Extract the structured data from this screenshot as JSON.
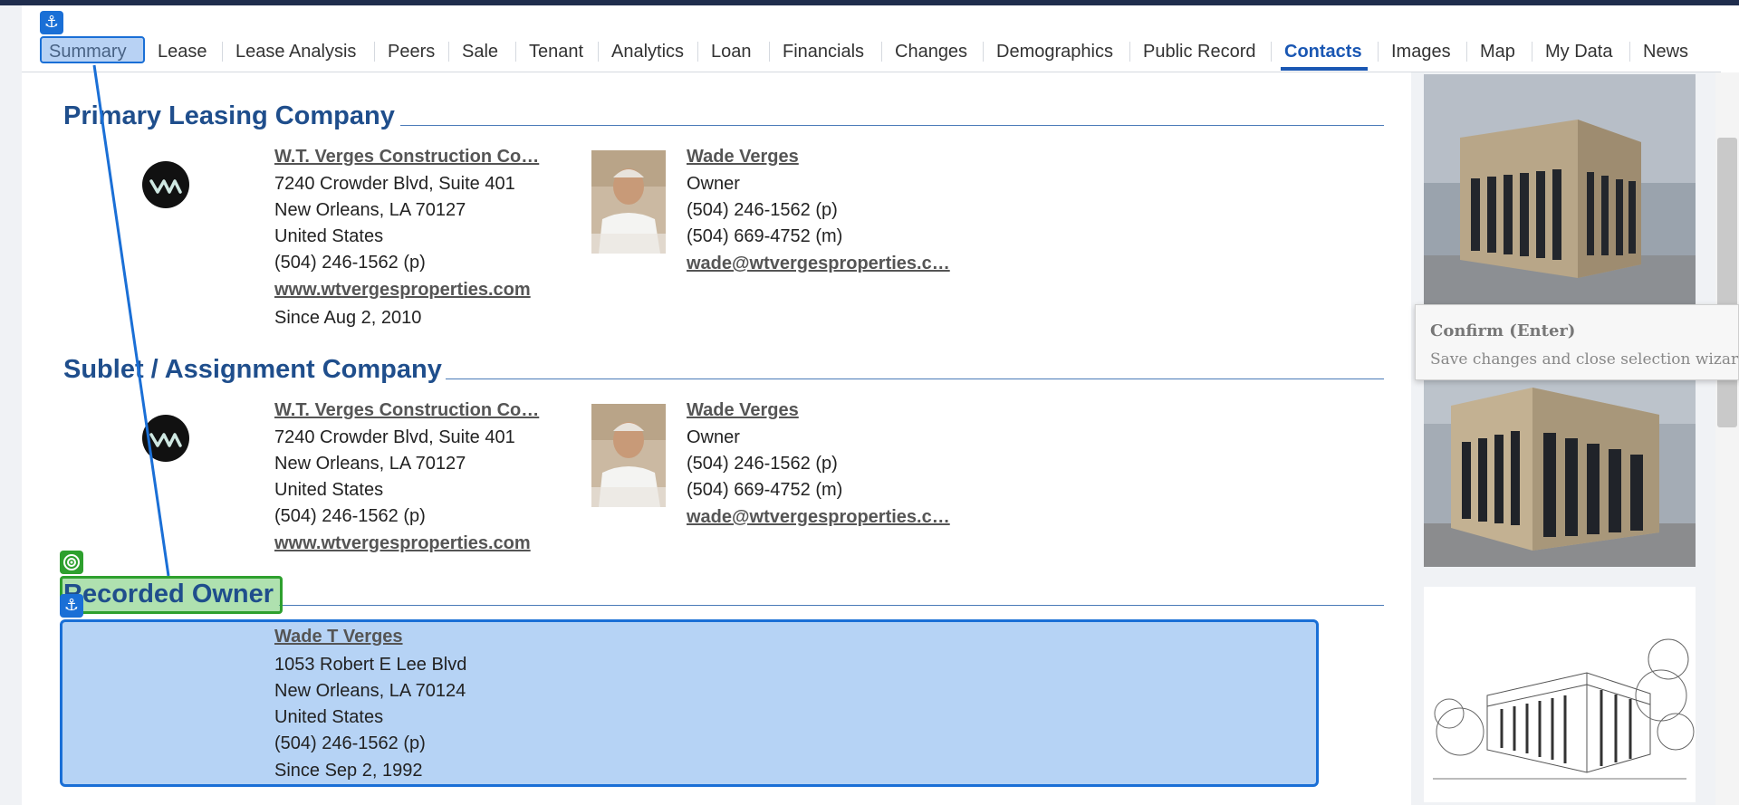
{
  "tabs": [
    {
      "label": "Summary"
    },
    {
      "label": "Lease"
    },
    {
      "label": "Lease Analysis"
    },
    {
      "label": "Peers"
    },
    {
      "label": "Sale"
    },
    {
      "label": "Tenant"
    },
    {
      "label": "Analytics"
    },
    {
      "label": "Loan"
    },
    {
      "label": "Financials"
    },
    {
      "label": "Changes"
    },
    {
      "label": "Demographics"
    },
    {
      "label": "Public Record"
    },
    {
      "label": "Contacts"
    },
    {
      "label": "Images"
    },
    {
      "label": "Map"
    },
    {
      "label": "My Data"
    },
    {
      "label": "News"
    }
  ],
  "active_tab": "Contacts",
  "sections": {
    "primary": {
      "title": "Primary Leasing Company",
      "company": {
        "name": "W.T. Verges Construction Co…",
        "address1": "7240 Crowder Blvd, Suite 401",
        "address2": "New Orleans, LA 70127",
        "country": "United States",
        "phone": "(504) 246-1562 (p)",
        "website": "www.wtvergesproperties.com",
        "since": "Since Aug 2, 2010"
      },
      "contact": {
        "name": "Wade Verges",
        "role": "Owner",
        "phone": "(504) 246-1562 (p)",
        "mobile": "(504) 669-4752 (m)",
        "email": "wade@wtvergesproperties.c…"
      }
    },
    "sublet": {
      "title": "Sublet / Assignment Company",
      "company": {
        "name": "W.T. Verges Construction Co…",
        "address1": "7240 Crowder Blvd, Suite 401",
        "address2": "New Orleans, LA 70127",
        "country": "United States",
        "phone": "(504) 246-1562 (p)",
        "website": "www.wtvergesproperties.com"
      },
      "contact": {
        "name": "Wade Verges",
        "role": "Owner",
        "phone": "(504) 246-1562 (p)",
        "mobile": "(504) 669-4752 (m)",
        "email": "wade@wtvergesproperties.c…"
      }
    },
    "owner": {
      "title": "Recorded Owner",
      "name": "Wade T Verges",
      "address1": "1053 Robert E Lee Blvd",
      "address2": "New Orleans, LA 70124",
      "country": "United States",
      "phone": "(504) 246-1562 (p)",
      "since": "Since Sep 2, 1992"
    }
  },
  "tooltip": {
    "title": "Confirm (Enter)",
    "text": "Save changes and close selection wizard."
  },
  "colors": {
    "accent": "#1a57b3",
    "section_title": "#1f4e8c",
    "selection": "#1a6fd6",
    "selection_green": "#2ea02e"
  },
  "icons": {
    "anchor": "⚓",
    "target": "◎"
  }
}
